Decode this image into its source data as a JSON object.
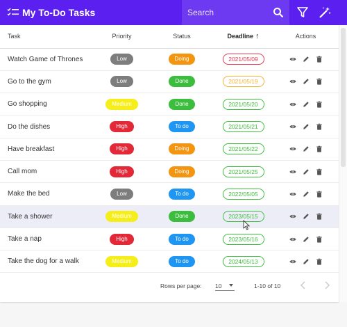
{
  "app": {
    "title": "My To-Do Tasks",
    "list_icon": "checklist-icon",
    "search_placeholder": "Search",
    "search_icon": "search-icon",
    "filter_icon": "filter-icon",
    "magic_icon": "magic-wand-icon"
  },
  "table": {
    "headers": {
      "task": "Task",
      "priority": "Priority",
      "status": "Status",
      "deadline": "Deadline",
      "actions": "Actions"
    },
    "sort": {
      "column": "deadline",
      "direction": "ascending",
      "icon": "arrow-up-icon"
    },
    "rows": [
      {
        "task": "Watch Game of Thrones",
        "priority": "Low",
        "status": "Doing",
        "deadline": "2021/05/09",
        "deadline_color": "#e53950"
      },
      {
        "task": "Go to the gym",
        "priority": "Low",
        "status": "Done",
        "deadline": "2021/05/19",
        "deadline_color": "#f3b23a"
      },
      {
        "task": "Go shopping",
        "priority": "Medium",
        "status": "Done",
        "deadline": "2021/05/20",
        "deadline_color": "#3dbd3d"
      },
      {
        "task": "Do the dishes",
        "priority": "High",
        "status": "To do",
        "deadline": "2021/05/21",
        "deadline_color": "#3dbd3d"
      },
      {
        "task": "Have breakfast",
        "priority": "High",
        "status": "Doing",
        "deadline": "2021/05/22",
        "deadline_color": "#3dbd3d"
      },
      {
        "task": "Call mom",
        "priority": "High",
        "status": "Doing",
        "deadline": "2021/05/25",
        "deadline_color": "#3dbd3d"
      },
      {
        "task": "Make the bed",
        "priority": "Low",
        "status": "To do",
        "deadline": "2022/05/05",
        "deadline_color": "#3dbd3d"
      },
      {
        "task": "Take a shower",
        "priority": "Medium",
        "status": "Done",
        "deadline": "2023/05/15",
        "deadline_color": "#3dbd3d"
      },
      {
        "task": "Take a nap",
        "priority": "High",
        "status": "To do",
        "deadline": "2023/05/16",
        "deadline_color": "#3dbd3d"
      },
      {
        "task": "Take the dog for a walk",
        "priority": "Medium",
        "status": "To do",
        "deadline": "2024/05/13",
        "deadline_color": "#3dbd3d"
      }
    ],
    "hovered_row": 7,
    "row_action_icons": [
      "eye-icon",
      "pencil-icon",
      "trash-icon"
    ]
  },
  "pagination": {
    "rows_per_page_label": "Rows per page:",
    "rows_per_page_value": "10",
    "range": "1-10 of 10",
    "prev_icon": "chevron-left-icon",
    "next_icon": "chevron-right-icon"
  },
  "colors": {
    "topbar": "#5b1ff0",
    "priority_low": "#7d7d7d",
    "priority_medium": "#f5ee1b",
    "priority_high": "#e32838",
    "status_doing": "#f39511",
    "status_done": "#3dbd3d",
    "status_todo": "#2096f3"
  }
}
